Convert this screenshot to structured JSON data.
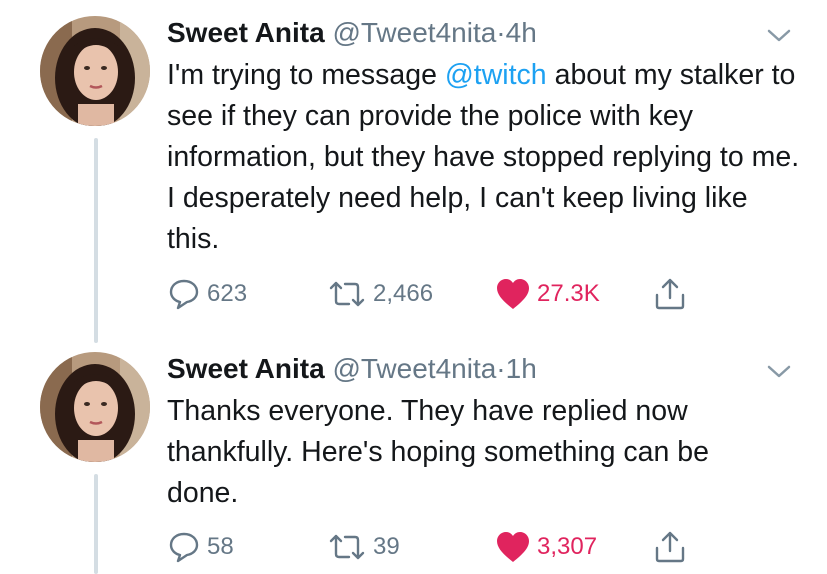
{
  "tweets": [
    {
      "display_name": "Sweet Anita",
      "handle": "@Tweet4nita",
      "separator": "·",
      "time": "4h",
      "text_before": "I'm trying to message ",
      "mention": "@twitch",
      "text_after": " about my stalker to see if they can provide the police with key information, but they have stopped replying to me. I desperately need help, I can't keep living like this.",
      "replies": "623",
      "retweets": "2,466",
      "likes": "27.3K"
    },
    {
      "display_name": "Sweet Anita",
      "handle": "@Tweet4nita",
      "separator": "·",
      "time": "1h",
      "text": "Thanks everyone. They have replied now thankfully. Here's hoping something can be done.",
      "replies": "58",
      "retweets": "39",
      "likes": "3,307"
    }
  ],
  "colors": {
    "text": "#14171a",
    "muted": "#657786",
    "link": "#1da1f2",
    "like": "#e0245e",
    "thread_line": "#d4dde3"
  },
  "icons": [
    "avatar-photo",
    "caret-down-icon",
    "reply-icon",
    "retweet-icon",
    "heart-icon",
    "share-icon"
  ]
}
